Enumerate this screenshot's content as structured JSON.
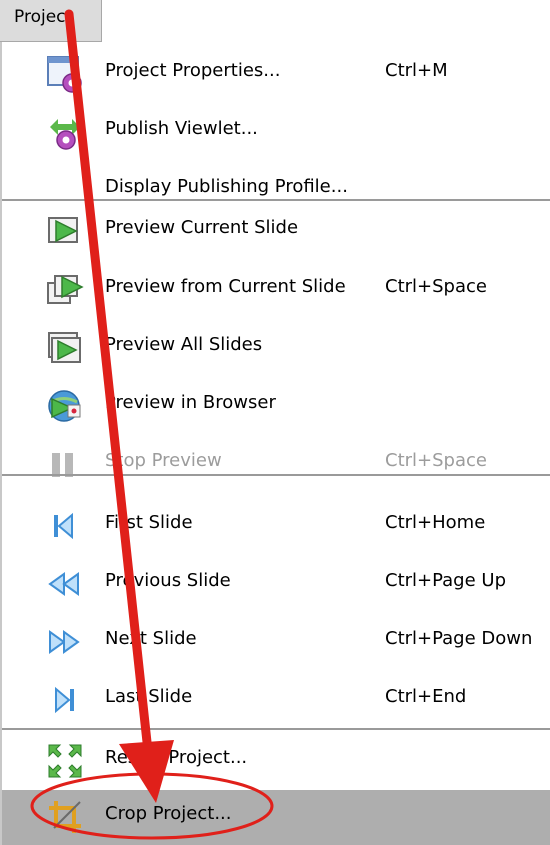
{
  "menu": {
    "title": "Project"
  },
  "items": [
    {
      "label": "Project Properties...",
      "shortcut": "Ctrl+M",
      "icon": "project-properties-icon",
      "enabled": true
    },
    {
      "label": "Publish Viewlet...",
      "shortcut": "",
      "icon": "publish-viewlet-icon",
      "enabled": true
    },
    {
      "label": "Display Publishing Profile...",
      "shortcut": "",
      "icon": "",
      "enabled": true
    },
    {
      "label": "Preview Current Slide",
      "shortcut": "",
      "icon": "preview-current-slide-icon",
      "enabled": true
    },
    {
      "label": "Preview from Current Slide",
      "shortcut": "Ctrl+Space",
      "icon": "preview-from-current-slide-icon",
      "enabled": true
    },
    {
      "label": "Preview All Slides",
      "shortcut": "",
      "icon": "preview-all-slides-icon",
      "enabled": true
    },
    {
      "label": "Preview in Browser",
      "shortcut": "",
      "icon": "preview-in-browser-icon",
      "enabled": true
    },
    {
      "label": "Stop Preview",
      "shortcut": "Ctrl+Space",
      "icon": "pause-icon",
      "enabled": false
    },
    {
      "label": "First Slide",
      "shortcut": "Ctrl+Home",
      "icon": "first-slide-icon",
      "enabled": true
    },
    {
      "label": "Previous Slide",
      "shortcut": "Ctrl+Page Up",
      "icon": "previous-slide-icon",
      "enabled": true
    },
    {
      "label": "Next Slide",
      "shortcut": "Ctrl+Page Down",
      "icon": "next-slide-icon",
      "enabled": true
    },
    {
      "label": "Last Slide",
      "shortcut": "Ctrl+End",
      "icon": "last-slide-icon",
      "enabled": true
    },
    {
      "label": "Resize Project...",
      "shortcut": "",
      "icon": "resize-project-icon",
      "enabled": true
    },
    {
      "label": "Crop Project...",
      "shortcut": "",
      "icon": "crop-project-icon",
      "enabled": true,
      "highlighted": true
    }
  ],
  "colors": {
    "annotation_red": "#e0201a",
    "highlight": "#aeaeae",
    "disabled_text": "#9c9c9c"
  }
}
